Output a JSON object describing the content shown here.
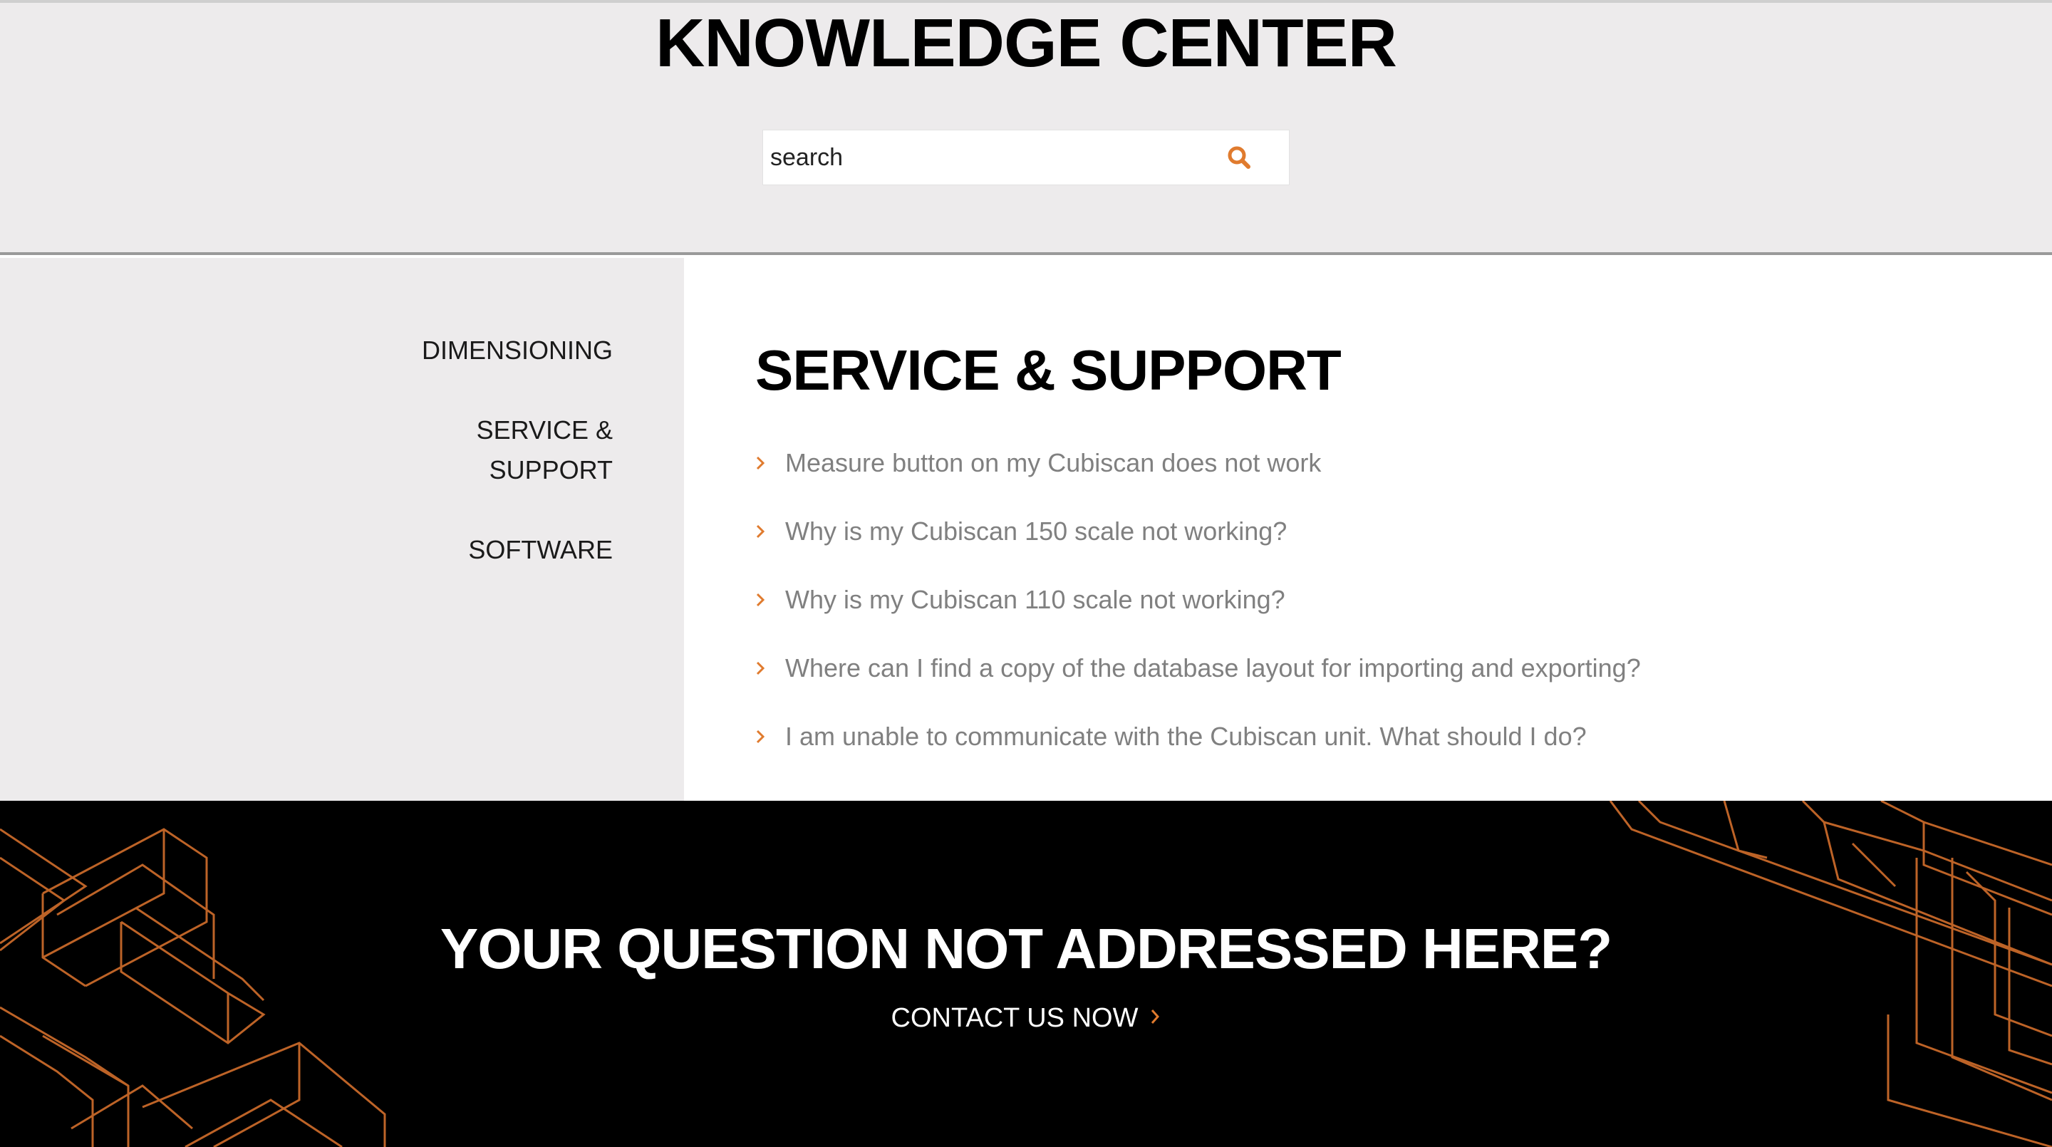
{
  "header": {
    "title": "KNOWLEDGE CENTER",
    "search": {
      "placeholder": "search",
      "value": ""
    }
  },
  "sidebar": {
    "items": [
      {
        "label": "DIMENSIONING"
      },
      {
        "label": "SERVICE & SUPPORT"
      },
      {
        "label": "SOFTWARE"
      }
    ]
  },
  "main": {
    "title": "SERVICE & SUPPORT",
    "faqs": [
      "Measure button on my Cubiscan does not work",
      "Why is my Cubiscan 150 scale not working?",
      "Why is my Cubiscan 110 scale not working?",
      "Where can I find a copy of the database layout for importing and exporting?",
      "I am unable to communicate with the Cubiscan unit. What should I do?"
    ]
  },
  "footer": {
    "title": "YOUR QUESTION NOT ADDRESSED HERE?",
    "contact_label": "CONTACT US NOW"
  },
  "colors": {
    "accent": "#e07b2e",
    "header_bg": "#edebec",
    "footer_bg": "#000000",
    "faq_text": "#808080"
  },
  "icons": {
    "search": "search-icon",
    "chevron": "chevron-right-icon"
  }
}
